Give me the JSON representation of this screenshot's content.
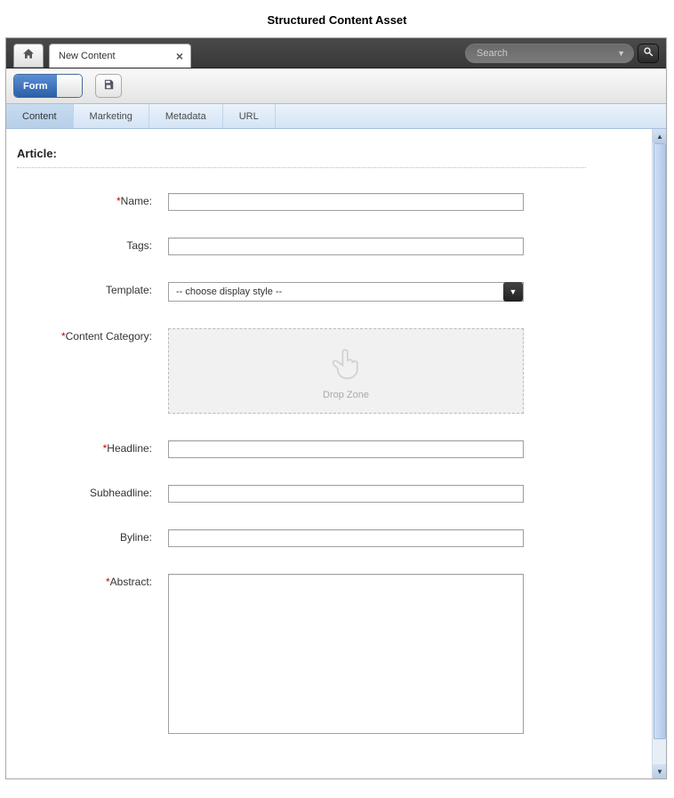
{
  "page": {
    "title": "Structured Content Asset"
  },
  "search": {
    "placeholder": "Search"
  },
  "tabs": {
    "main": {
      "label": "New Content"
    }
  },
  "toolbar": {
    "view_form_label": "Form"
  },
  "subtabs": {
    "items": [
      {
        "label": "Content"
      },
      {
        "label": "Marketing"
      },
      {
        "label": "Metadata"
      },
      {
        "label": "URL"
      }
    ]
  },
  "form": {
    "section": "Article:",
    "labels": {
      "name": "Name:",
      "tags": "Tags:",
      "template": "Template:",
      "content_category": "Content Category:",
      "headline": "Headline:",
      "subheadline": "Subheadline:",
      "byline": "Byline:",
      "abstract": "Abstract:"
    },
    "values": {
      "name": "",
      "tags": "",
      "template_selected": "-- choose display style --",
      "headline": "",
      "subheadline": "",
      "byline": "",
      "abstract": ""
    },
    "dropzone_label": "Drop Zone"
  }
}
